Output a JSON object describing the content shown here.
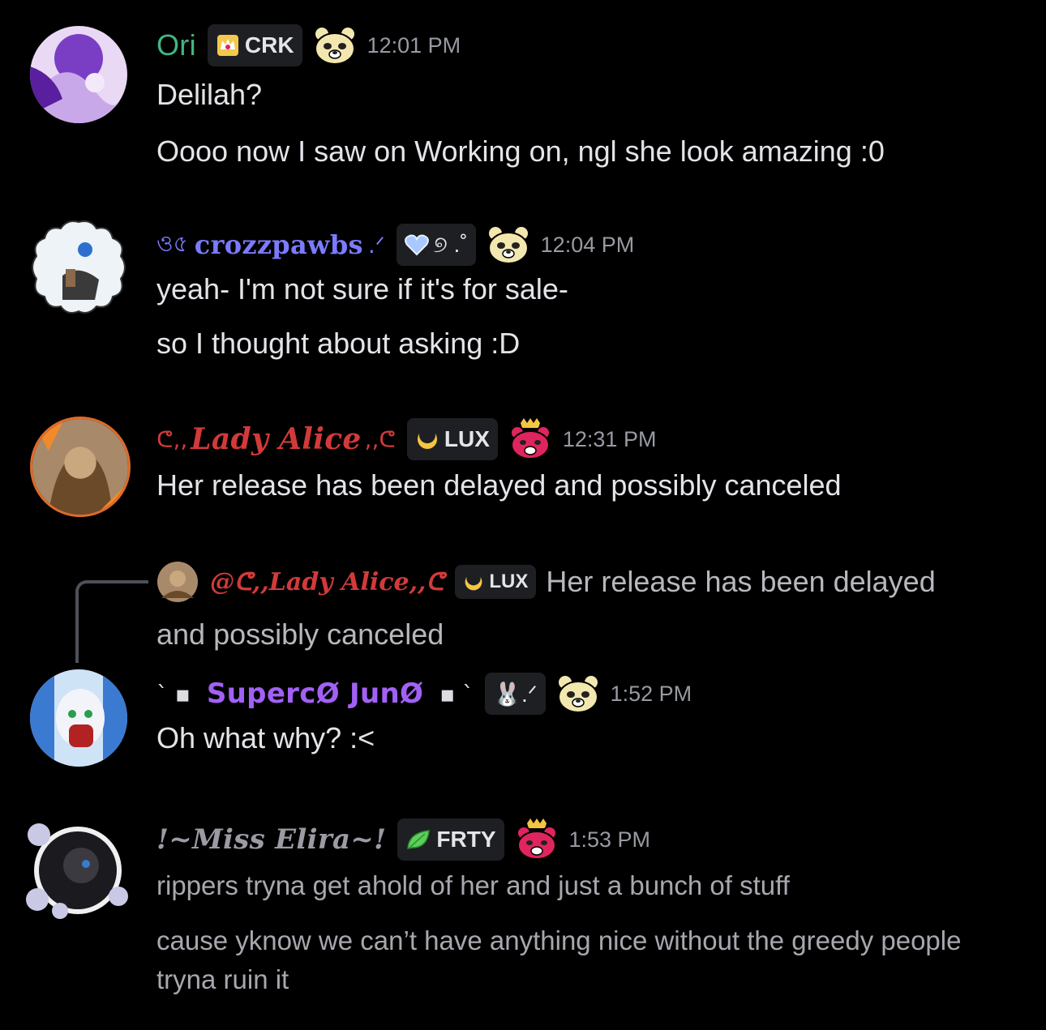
{
  "messages": [
    {
      "username": "Ori",
      "tag": "CRK",
      "time": "12:01 PM",
      "lines": [
        "Delilah?",
        "Oooo now I saw on Working on, ngl she look amazing :0"
      ]
    },
    {
      "username": "crozzpawbs",
      "prefix": "ও৫",
      "suffix": ".ᐟ",
      "tag": "୭ .˚",
      "time": "12:04 PM",
      "lines": [
        "yeah- I'm not sure if it's for sale-",
        "so I thought about asking :D"
      ]
    },
    {
      "username": "Lady Alice",
      "prefix": "ᕦ,,",
      "suffix": ",,ᕦ",
      "tag": "LUX",
      "time": "12:31 PM",
      "lines": [
        "Her release has been delayed and possibly canceled"
      ]
    },
    {
      "reply": {
        "mention": "@ᕦ,,Lady Alice,,ᕦ",
        "tag": "LUX",
        "text_line1": "Her release has been delayed",
        "text_line2": "and possibly canceled"
      },
      "username": "SupercØ JunØ",
      "prefix": "ˋ  ▪",
      "suffix": "▪  ˋ",
      "tag": "🐰.ᐟ",
      "time": "1:52 PM",
      "lines": [
        "Oh what why? :<"
      ]
    },
    {
      "username": "!~Miss Elira~!",
      "tag": "FRTY",
      "time": "1:53 PM",
      "lines": [
        "rippers tryna get ahold of her and just a bunch of stuff",
        "cause yknow we can’t have anything nice without the greedy people",
        "tryna ruin it"
      ]
    }
  ],
  "colors": {
    "ori": "#43b581",
    "crozz": "#7b7bff",
    "alice": "#d23a3a",
    "juno": "#a261f5",
    "elira": "#9a9ba3"
  }
}
